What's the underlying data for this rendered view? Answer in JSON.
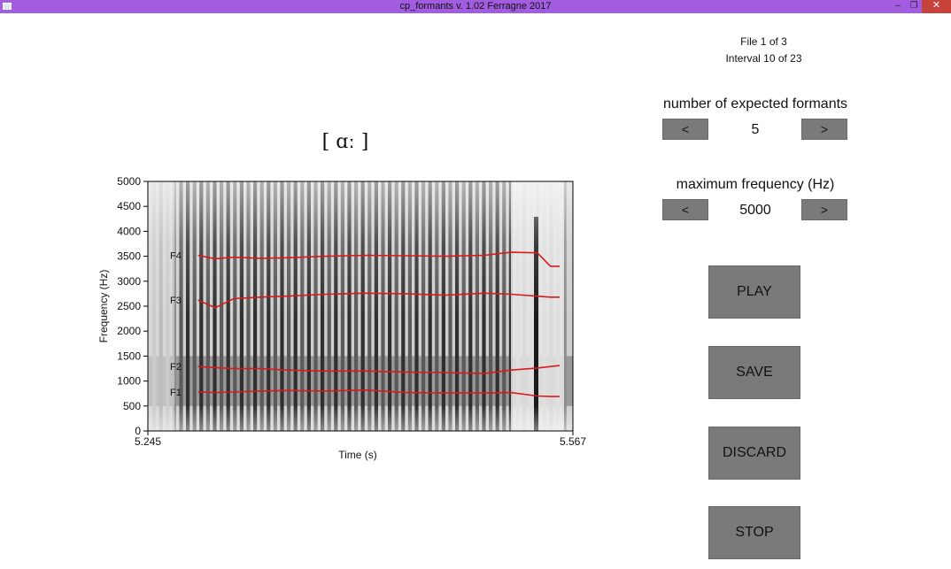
{
  "window": {
    "title": "cp_formants v. 1.02 Ferragne 2017",
    "minimize_icon": "minimize-icon",
    "maximize_icon": "restore-icon",
    "close_icon": "close-icon"
  },
  "info": {
    "file": "File 1 of 3",
    "interval": "Interval 10 of 23"
  },
  "formants_control": {
    "heading": "number of expected formants",
    "decrease": "<",
    "value": "5",
    "increase": ">"
  },
  "maxfreq_control": {
    "heading": "maximum frequency (Hz)",
    "decrease": "<",
    "value": "5000",
    "increase": ">"
  },
  "actions": {
    "play": "PLAY",
    "save": "SAVE",
    "discard": "DISCARD",
    "stop": "STOP"
  },
  "spectrogram": {
    "segment_label": "[ ɑː ]",
    "xlabel": "Time (s)",
    "ylabel": "Frequency (Hz)",
    "x_start": "5.245",
    "x_end": "5.567",
    "y_ticks": [
      "0",
      "500",
      "1000",
      "1500",
      "2000",
      "2500",
      "3000",
      "3500",
      "4000",
      "4500",
      "5000"
    ],
    "formant_labels": [
      "F1",
      "F2",
      "F3",
      "F4"
    ],
    "track_color": "#d81b1b"
  },
  "chart_data": {
    "type": "line",
    "x_range": [
      5.245,
      5.567
    ],
    "ylim": [
      0,
      5000
    ],
    "xlabel": "Time (s)",
    "ylabel": "Frequency (Hz)",
    "x": [
      5.283,
      5.296,
      5.31,
      5.33,
      5.35,
      5.38,
      5.41,
      5.44,
      5.47,
      5.5,
      5.52,
      5.54,
      5.55,
      5.557
    ],
    "series": [
      {
        "name": "F1",
        "values": [
          780,
          770,
          780,
          800,
          810,
          800,
          820,
          770,
          760,
          760,
          770,
          700,
          690,
          690
        ]
      },
      {
        "name": "F2",
        "values": [
          1290,
          1270,
          1250,
          1250,
          1220,
          1200,
          1200,
          1180,
          1170,
          1150,
          1220,
          1260,
          1290,
          1310
        ]
      },
      {
        "name": "F3",
        "values": [
          2620,
          2470,
          2650,
          2680,
          2700,
          2740,
          2760,
          2750,
          2720,
          2760,
          2740,
          2700,
          2680,
          2680
        ]
      },
      {
        "name": "F4",
        "values": [
          3520,
          3450,
          3480,
          3460,
          3470,
          3500,
          3520,
          3510,
          3500,
          3520,
          3580,
          3570,
          3300,
          3300
        ]
      }
    ]
  }
}
